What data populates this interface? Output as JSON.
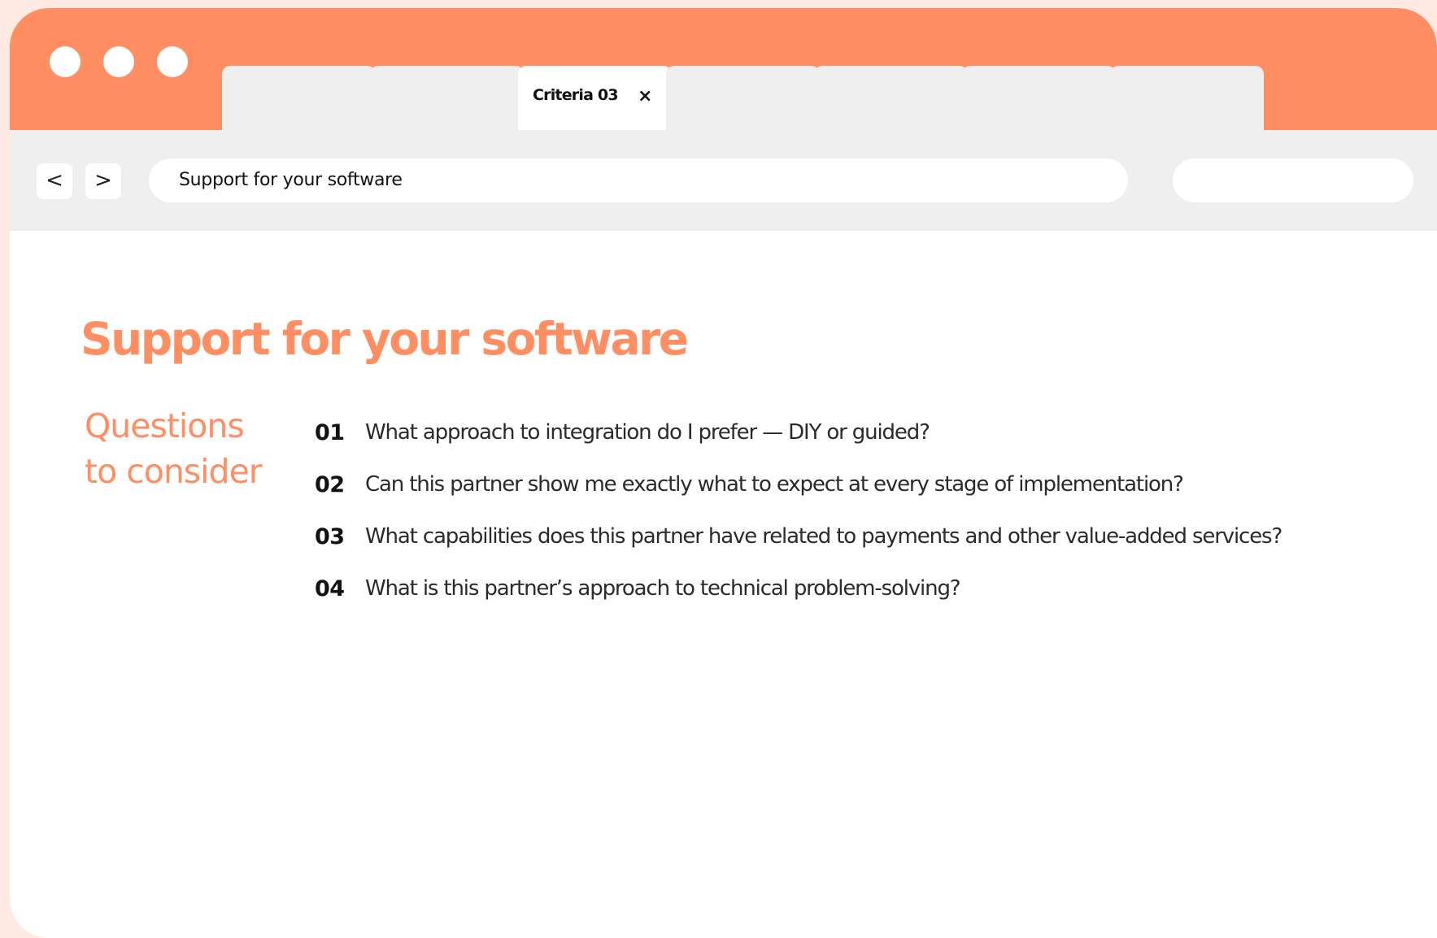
{
  "colors": {
    "accent": "#ff8f63",
    "chrome": "#eeefee",
    "background": "#ffe9e3"
  },
  "browser": {
    "tabs": [
      {
        "label": ""
      },
      {
        "label": ""
      },
      {
        "label": "Criteria 03",
        "active": true
      },
      {
        "label": ""
      },
      {
        "label": ""
      },
      {
        "label": ""
      },
      {
        "label": ""
      }
    ],
    "close_icon": "×",
    "back_label": "<",
    "forward_label": ">",
    "address": "Support for your software",
    "search": ""
  },
  "main": {
    "title": "Support for your software",
    "side_heading": {
      "line1": "Questions",
      "line2": "to consider"
    },
    "questions": [
      {
        "number": "01",
        "text": "What approach to integration do I prefer — DIY or guided?"
      },
      {
        "number": "02",
        "text": "Can this partner show me exactly what to expect at every stage of implementation?"
      },
      {
        "number": "03",
        "text": "What capabilities does this partner have related to payments and other value-added services?"
      },
      {
        "number": "04",
        "text": "What is this partner’s approach to technical problem-solving?"
      }
    ]
  }
}
